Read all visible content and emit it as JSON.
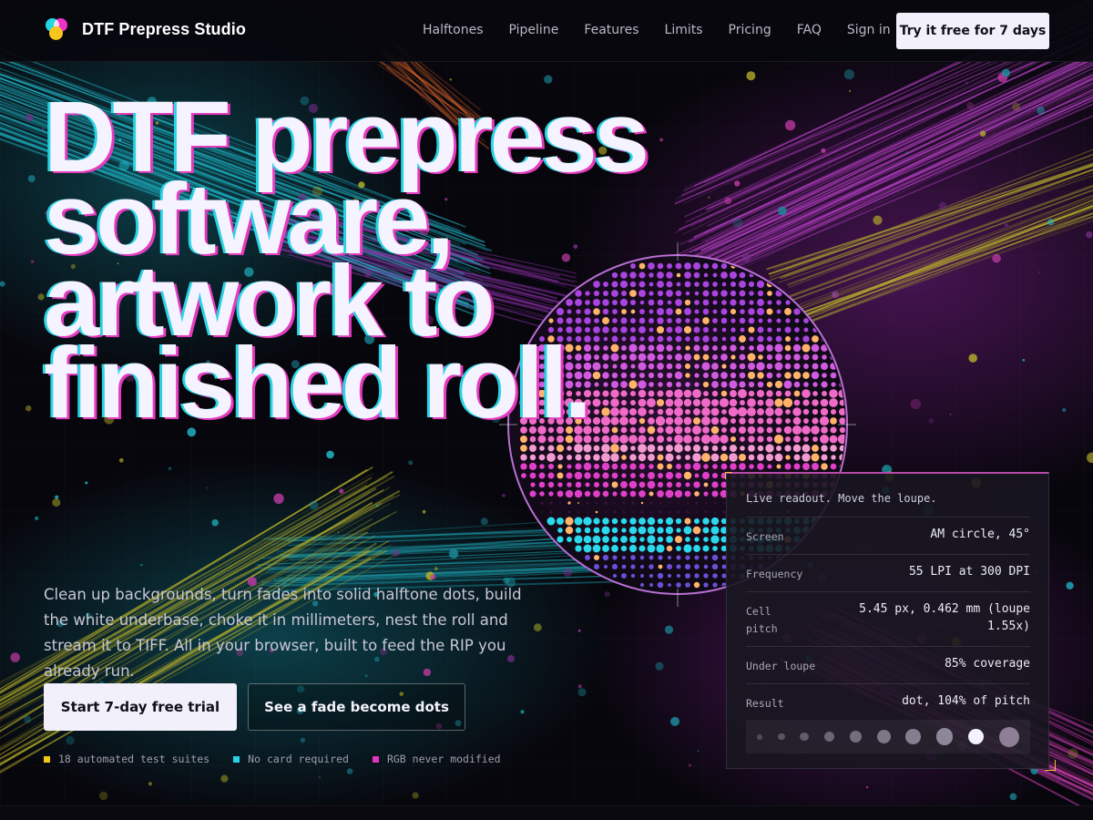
{
  "brand": {
    "name": "DTF Prepress Studio",
    "logo_icon": "cmy-dots-logo-icon"
  },
  "nav": {
    "items": [
      "Halftones",
      "Pipeline",
      "Features",
      "Limits",
      "Pricing",
      "FAQ",
      "Sign in"
    ],
    "cta": "Try it free for 7 days"
  },
  "hero": {
    "title_lines": [
      "DTF prepress",
      "software,",
      "artwork to",
      "finished roll."
    ],
    "lead": "Clean up backgrounds, turn fades into solid halftone dots, build the white underbase, choke it in millimeters, nest the roll and stream it to TIFF. All in your browser, built to feed the RIP you already run.",
    "primary_button": "Start 7-day free trial",
    "secondary_button": "See a fade become dots",
    "facts": [
      {
        "text": "18 automated test suites",
        "color": "#f2c417"
      },
      {
        "text": "No card required",
        "color": "#24d4e6"
      },
      {
        "text": "RGB never modified",
        "color": "#e534c0"
      }
    ]
  },
  "readout": {
    "heading": "Live readout. Move the loupe.",
    "rows": [
      {
        "label": "Screen",
        "value": "AM circle, 45°"
      },
      {
        "label": "Frequency",
        "value": "55 LPI at 300 DPI"
      },
      {
        "label": "Cell pitch",
        "value": "5.45 px, 0.462 mm (loupe 1.55x)"
      },
      {
        "label": "Under loupe",
        "value": "85% coverage"
      },
      {
        "label": "Result",
        "value": "dot, 104% of pitch"
      }
    ],
    "tone_steps": 10,
    "active_step": 9
  },
  "colors": {
    "cyan": "#24d4e6",
    "magenta": "#e534c0",
    "yellow": "#f2c417",
    "background": "#07060c"
  }
}
